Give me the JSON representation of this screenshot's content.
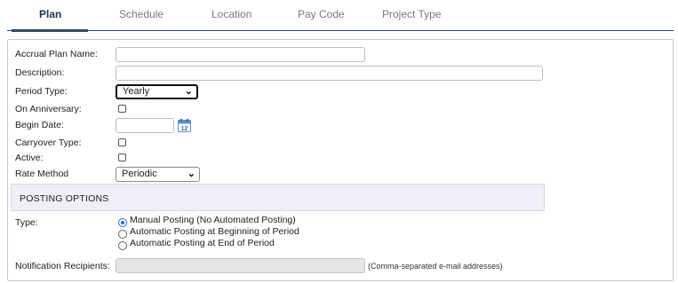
{
  "tabs": [
    {
      "label": "Plan",
      "active": true
    },
    {
      "label": "Schedule",
      "active": false
    },
    {
      "label": "Location",
      "active": false
    },
    {
      "label": "Pay Code",
      "active": false
    },
    {
      "label": "Project Type",
      "active": false
    }
  ],
  "form": {
    "accrual_plan_name": {
      "label": "Accrual Plan Name:",
      "value": ""
    },
    "description": {
      "label": "Description:",
      "value": ""
    },
    "period_type": {
      "label": "Period Type:",
      "value": "Yearly"
    },
    "on_anniversary": {
      "label": "On Anniversary:",
      "checked": false
    },
    "begin_date": {
      "label": "Begin Date:",
      "value": ""
    },
    "carryover_type": {
      "label": "Carryover Type:",
      "checked": false
    },
    "active": {
      "label": "Active:",
      "checked": false
    },
    "rate_method": {
      "label": "Rate Method",
      "value": "Periodic"
    }
  },
  "posting": {
    "section_title": "POSTING OPTIONS",
    "type_label": "Type:",
    "options": [
      {
        "label": "Manual Posting (No Automated Posting)",
        "selected": true
      },
      {
        "label": "Automatic Posting at Beginning of Period",
        "selected": false
      },
      {
        "label": "Automatic Posting at End of Period",
        "selected": false
      }
    ]
  },
  "notification": {
    "label": "Notification Recipients:",
    "value": "",
    "hint": "(Comma-separated e-mail addresses)"
  },
  "colors": {
    "accent": "#2d4a6b",
    "radio_selected": "#1a73e8",
    "section_bg": "#efeff7"
  },
  "icons": {
    "calendar": "calendar-icon",
    "dropdown": "chevron-down-icon"
  }
}
